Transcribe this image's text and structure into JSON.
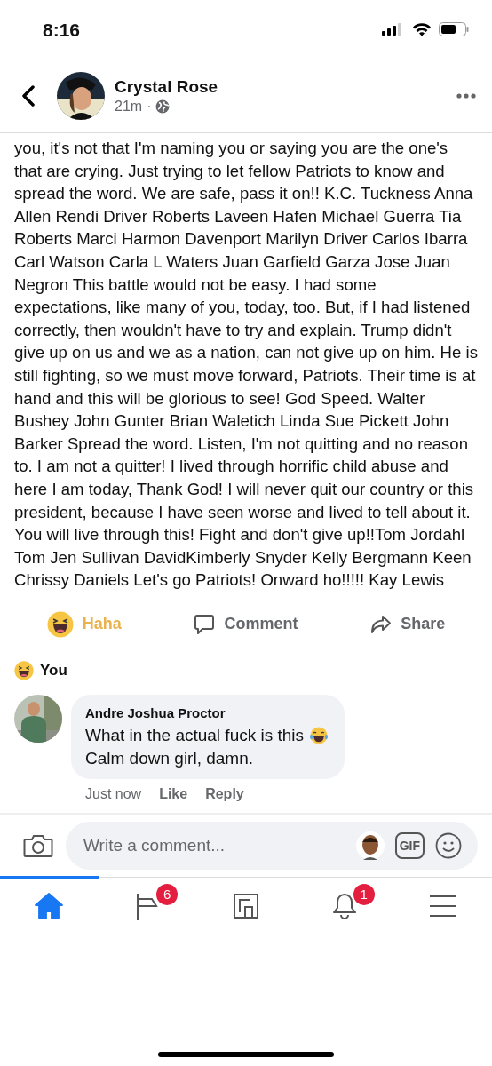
{
  "status_bar": {
    "time": "8:16"
  },
  "header": {
    "author": "Crystal Rose",
    "time": "21m",
    "separator": "·"
  },
  "post": {
    "text": "you, it's not that I'm naming you or saying you are the one's that are crying. Just trying to let fellow Patriots to know and spread the word. We are safe, pass it on!! K.C. Tuckness  Anna Allen Rendi Driver Roberts  Laveen Hafen Michael Guerra  Tia Roberts Marci Harmon Davenport Marilyn Driver  Carlos Ibarra  Carl Watson Carla L Waters Juan Garfield Garza Jose Juan Negron This battle would not be easy. I had some expectations, like many of you, today, too. But, if I had  listened correctly, then wouldn't have to try and explain. Trump didn't give up on us and we as a nation, can not give up on him. He is still fighting, so we must move forward, Patriots. Their time is at hand and this will be glorious to see! God Speed. Walter Bushey  John Gunter Brian Waletich Linda Sue Pickett John Barker Spread the word. Listen, I'm not quitting and no reason to. I am not a quitter! I lived through horrific child abuse and here I am today, Thank God! I will never quit our country or this president, because I have seen worse and lived to tell about it. You will live through this! Fight and don't give up!!Tom Jordahl  Tom Jen Sullivan DavidKimberly Snyder Kelly Bergmann Keen Chrissy Daniels Let's go Patriots! Onward ho!!!!! Kay Lewis"
  },
  "actions": [
    {
      "kind": "haha",
      "label": "Haha",
      "selected": true
    },
    {
      "kind": "comment",
      "label": "Comment",
      "selected": false
    },
    {
      "kind": "share",
      "label": "Share",
      "selected": false
    }
  ],
  "reactions": {
    "label": "You"
  },
  "comment": {
    "author": "Andre Joshua Proctor",
    "lines": [
      "What in the actual fuck is this",
      "Calm down girl, damn."
    ],
    "time": "Just now",
    "actions": [
      "Like",
      "Reply"
    ]
  },
  "composer": {
    "placeholder": "Write a comment...",
    "gif": "GIF"
  },
  "tabs": [
    {
      "kind": "home",
      "selected": true
    },
    {
      "kind": "pages",
      "selected": false,
      "badge": "6"
    },
    {
      "kind": "gaming",
      "selected": false
    },
    {
      "kind": "bell",
      "selected": false,
      "badge": "1"
    },
    {
      "kind": "menu",
      "selected": false
    }
  ]
}
